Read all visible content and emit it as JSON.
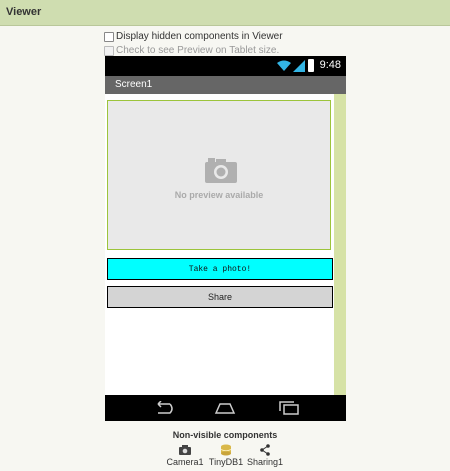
{
  "header": {
    "title": "Viewer"
  },
  "options": {
    "display_hidden": "Display hidden components in Viewer",
    "tablet_preview": "Check to see Preview on Tablet size."
  },
  "phone": {
    "time": "9:48",
    "screen_title": "Screen1",
    "image_placeholder": "No preview available",
    "photo_button": "Take a photo!",
    "share_button": "Share"
  },
  "nonvisible": {
    "title": "Non-visible components",
    "items": [
      {
        "label": "Camera1",
        "icon": "camera-icon"
      },
      {
        "label": "TinyDB1",
        "icon": "database-icon"
      },
      {
        "label": "Sharing1",
        "icon": "share-icon"
      }
    ]
  },
  "colors": {
    "header_bg": "#cfddb0",
    "photo_button_bg": "#00ffff",
    "share_button_bg": "#d4d4d4",
    "accent_border": "#9cc43b"
  }
}
